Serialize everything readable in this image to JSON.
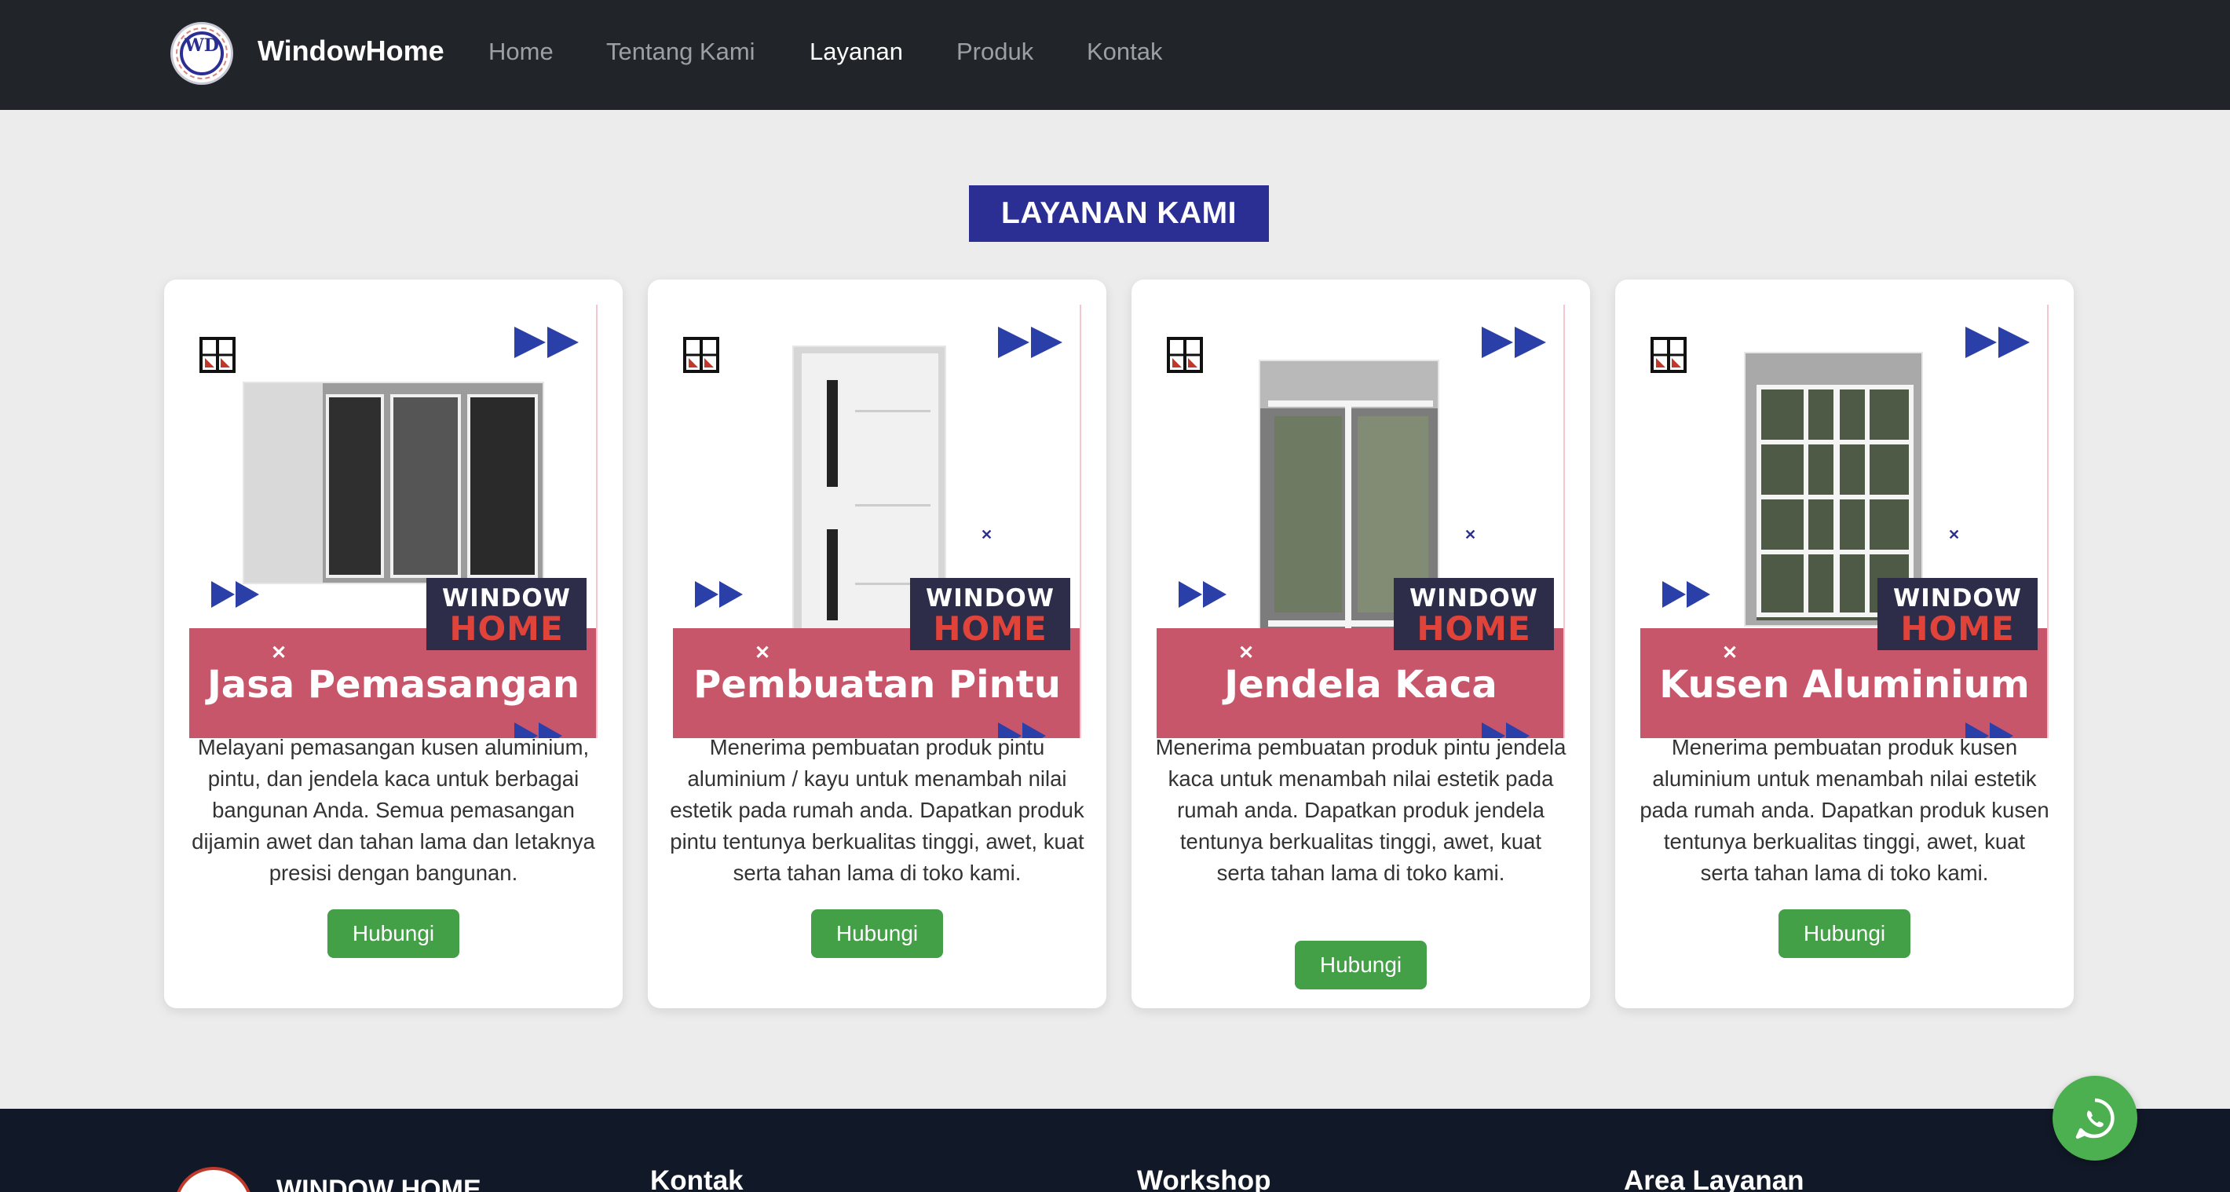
{
  "navbar": {
    "logo_text": "WD",
    "brand": "WindowHome",
    "links": [
      {
        "label": "Home",
        "active": false
      },
      {
        "label": "Tentang Kami",
        "active": false
      },
      {
        "label": "Layanan",
        "active": true
      },
      {
        "label": "Produk",
        "active": false
      },
      {
        "label": "Kontak",
        "active": false
      }
    ]
  },
  "section": {
    "title": "LAYANAN KAMI"
  },
  "banner_brand": {
    "line1": "WINDOW",
    "line2": "HOME"
  },
  "cards": [
    {
      "banner_label": "Jasa Pemasangan",
      "description": "Melayani pemasangan kusen aluminium, pintu, dan jendela kaca untuk berbagai bangunan Anda. Semua pemasangan dijamin awet dan tahan lama dan letaknya presisi dengan bangunan.",
      "button": "Hubungi"
    },
    {
      "banner_label": "Pembuatan Pintu",
      "description": "Menerima pembuatan produk pintu aluminium / kayu untuk menambah nilai estetik pada rumah anda. Dapatkan produk pintu tentunya berkualitas tinggi, awet, kuat serta tahan lama di toko kami.",
      "button": "Hubungi"
    },
    {
      "banner_label": "Jendela Kaca",
      "description": "Menerima pembuatan produk pintu jendela kaca untuk menambah nilai estetik pada rumah anda. Dapatkan produk jendela tentunya berkualitas tinggi, awet, kuat serta tahan lama di toko kami.",
      "button": "Hubungi"
    },
    {
      "banner_label": "Kusen Aluminium",
      "description": "Menerima pembuatan produk kusen aluminium untuk menambah nilai estetik pada rumah anda. Dapatkan produk kusen tentunya berkualitas tinggi, awet, kuat serta tahan lama di toko kami.",
      "button": "Hubungi"
    }
  ],
  "footer": {
    "brand": "WINDOW HOME",
    "headings": [
      "Kontak",
      "Workshop",
      "Area Layanan"
    ]
  },
  "whatsapp": {
    "icon": "whatsapp-icon"
  },
  "colors": {
    "navbar_bg": "#212529",
    "accent_blue": "#2b2f94",
    "banner_pink": "#c8566b",
    "button_green": "#43a047",
    "footer_bg": "#111827",
    "whatsapp_green": "#4caf50"
  }
}
